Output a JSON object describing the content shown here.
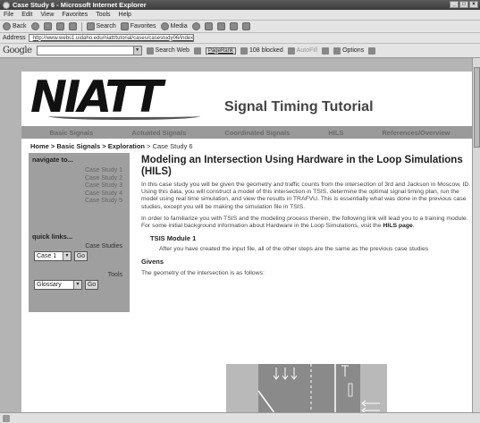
{
  "window": {
    "title": "Case Study 6 - Microsoft Internet Explorer"
  },
  "menu": [
    "File",
    "Edit",
    "View",
    "Favorites",
    "Tools",
    "Help"
  ],
  "toolbar": {
    "back": "Back",
    "search": "Search",
    "favorites": "Favorites",
    "media": "Media"
  },
  "address": {
    "label": "Address",
    "url": "http://www.webs1.uidaho.edu/niatt/tutorial/cases/casestudy06/index.htm"
  },
  "googlebar": {
    "logo": "Google",
    "search_web": "Search Web",
    "pagerank": "PageRank",
    "blocked": "108 blocked",
    "autofill": "AutoFill",
    "options": "Options"
  },
  "site": {
    "logo": "NIATT",
    "title": "Signal Timing Tutorial",
    "nav": [
      "Basic Signals",
      "Actuated Signals",
      "Coordinated Signals",
      "HILS",
      "References/Overview"
    ]
  },
  "breadcrumb": {
    "home": "Home",
    "section": "Basic Signals",
    "exploration": "Exploration",
    "current": "Case Study 6"
  },
  "sidebar": {
    "navigate_heading": "navigate to...",
    "case_studies": [
      "Case Study 1",
      "Case Study 2",
      "Case Study 3",
      "Case Study 4",
      "Case Study 5"
    ],
    "quick_heading": "quick links...",
    "case_label": "Case Studies",
    "case_selected": "Case 1",
    "tools_label": "Tools",
    "tools_selected": "Glossary",
    "go": "Go"
  },
  "content": {
    "heading": "Modeling an Intersection Using Hardware in the Loop Simulations (HILS)",
    "para1": "In this case study you will be given the geometry and traffic counts from the intersection of 3rd and Jackson in Moscow, ID. Using this data, you will construct a model of this intersection in TSIS, determine the optimal signal timing plan, run the model using real time simulation, and view the results in TRAFVU. This is essentially what was done in the previous case studies, except you will be making the simulation file in TSIS.",
    "para2_prefix": "In order to familiarize you with TSIS and the modeling process therein, the following link will lead you to a training module. For some initial background information about Hardware in the Loop Simulations, visit the ",
    "para2_link": "HILS page",
    "para2_suffix": ".",
    "module_title": "TSIS Module 1",
    "module_text": "After you have created the input file, all of the other steps are the same as the previous case studies",
    "givens_heading": "Givens",
    "geometry_text": "The geometry of the intersection is as follows:"
  },
  "statusbar": {
    "text": ""
  }
}
